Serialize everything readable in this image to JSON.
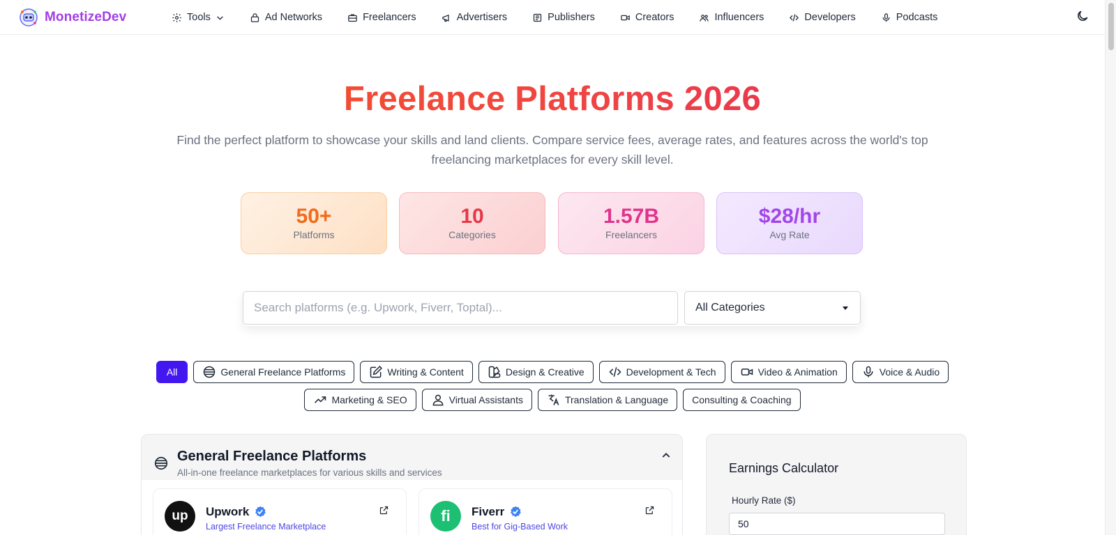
{
  "brand": {
    "name": "MonetizeDev"
  },
  "nav": {
    "items": [
      {
        "label": "Tools",
        "icon": "gear-icon"
      },
      {
        "label": "Ad Networks",
        "icon": "lock-icon"
      },
      {
        "label": "Freelancers",
        "icon": "briefcase-icon"
      },
      {
        "label": "Advertisers",
        "icon": "megaphone-icon"
      },
      {
        "label": "Publishers",
        "icon": "newspaper-icon"
      },
      {
        "label": "Creators",
        "icon": "video-icon"
      },
      {
        "label": "Influencers",
        "icon": "users-icon"
      },
      {
        "label": "Developers",
        "icon": "code-icon"
      },
      {
        "label": "Podcasts",
        "icon": "mic-icon"
      }
    ],
    "theme_icon": "moon-icon"
  },
  "hero": {
    "title": "Freelance Platforms 2026",
    "subtitle": "Find the perfect platform to showcase your skills and land clients. Compare service fees, average rates, and features across the world's top freelancing marketplaces for every skill level."
  },
  "stats": [
    {
      "value": "50+",
      "label": "Platforms",
      "color": "#f26a1b"
    },
    {
      "value": "10",
      "label": "Categories",
      "color": "#e63947"
    },
    {
      "value": "1.57B",
      "label": "Freelancers",
      "color": "#e0338a"
    },
    {
      "value": "$28/hr",
      "label": "Avg Rate",
      "color": "#a346e8"
    }
  ],
  "search": {
    "placeholder": "Search platforms (e.g. Upwork, Fiverr, Toptal)...",
    "category_selected": "All Categories"
  },
  "filters": {
    "all": "All",
    "row1": [
      {
        "label": "General Freelance Platforms",
        "icon": "globe-icon"
      },
      {
        "label": "Writing & Content",
        "icon": "pencil-square-icon"
      },
      {
        "label": "Design & Creative",
        "icon": "palette-icon"
      },
      {
        "label": "Development & Tech",
        "icon": "code-icon"
      },
      {
        "label": "Video & Animation",
        "icon": "video-icon"
      },
      {
        "label": "Voice & Audio",
        "icon": "mic-icon"
      }
    ],
    "row2": [
      {
        "label": "Marketing & SEO",
        "icon": "trending-up-icon"
      },
      {
        "label": "Virtual Assistants",
        "icon": "user-icon"
      },
      {
        "label": "Translation & Language",
        "icon": "translate-icon"
      },
      {
        "label": "Consulting & Coaching",
        "icon": ""
      }
    ]
  },
  "section": {
    "title": "General Freelance Platforms",
    "description": "All-in-one freelance marketplaces for various skills and services",
    "platforms": [
      {
        "name": "Upwork",
        "logo_text": "up",
        "tagline": "Largest Freelance Marketplace",
        "logo_color": "#111111"
      },
      {
        "name": "Fiverr",
        "logo_text": "fi",
        "tagline": "Best for Gig-Based Work",
        "logo_color": "#1dbf73"
      }
    ]
  },
  "calculator": {
    "title": "Earnings Calculator",
    "hourly_label": "Hourly Rate ($)",
    "hourly_value": "50"
  },
  "colors": {
    "accent": "#4318f0",
    "brand": "#a23ee6",
    "link": "#4f46e5",
    "verified": "#3b82f6"
  }
}
